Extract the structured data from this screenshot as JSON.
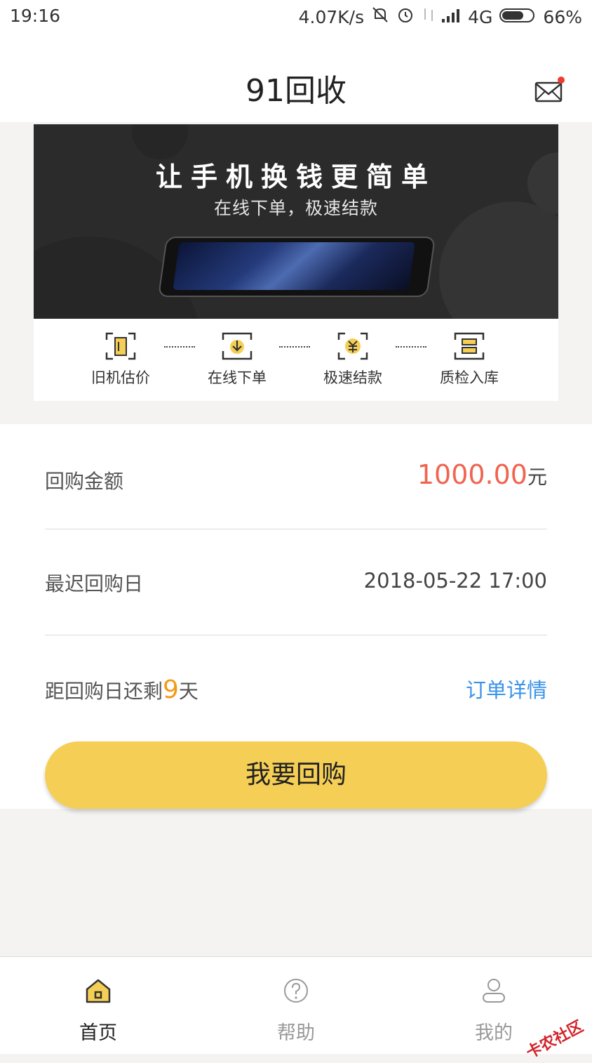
{
  "status_bar": {
    "time": "19:16",
    "speed": "4.07K/s",
    "network": "4G",
    "battery": "66%"
  },
  "header": {
    "title": "91回收"
  },
  "banner": {
    "headline": "让手机换钱更简单",
    "subline": "在线下单，极速结款"
  },
  "steps": [
    {
      "label": "旧机估价"
    },
    {
      "label": "在线下单"
    },
    {
      "label": "极速结款"
    },
    {
      "label": "质检入库"
    }
  ],
  "order": {
    "amount_label": "回购金额",
    "amount_value": "1000.00",
    "amount_unit": "元",
    "deadline_label": "最迟回购日",
    "deadline_value": "2018-05-22 17:00",
    "remaining_prefix": "距回购日还剩",
    "remaining_days": "9",
    "remaining_suffix": "天",
    "detail_link": "订单详情",
    "action_button": "我要回购"
  },
  "tabbar": {
    "items": [
      {
        "label": "首页",
        "active": true
      },
      {
        "label": "帮助",
        "active": false
      },
      {
        "label": "我的",
        "active": false
      }
    ]
  },
  "watermark": "卡农社区",
  "colors": {
    "accent_yellow": "#f5cf55",
    "amount_red": "#f06450",
    "days_orange": "#f39a16",
    "link_blue": "#3a93e8"
  }
}
